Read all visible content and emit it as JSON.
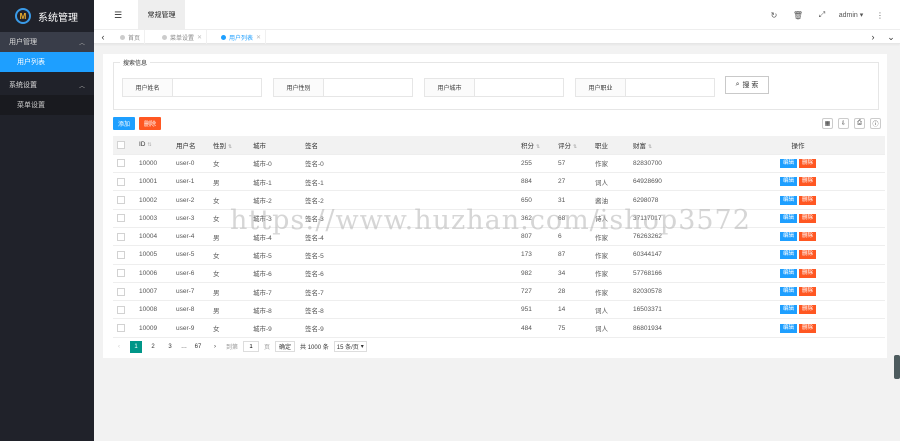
{
  "app": {
    "title": "系统管理"
  },
  "sidebar": {
    "groups": [
      {
        "label": "用户管理",
        "items": [
          "用户列表"
        ]
      },
      {
        "label": "系统设置",
        "items": [
          "菜单设置"
        ]
      }
    ]
  },
  "header": {
    "tab": "常规管理",
    "user": "admin",
    "icons": [
      "refresh-icon",
      "trash-icon",
      "fullscreen-icon",
      "more-icon"
    ]
  },
  "tabs": [
    {
      "label": "首页"
    },
    {
      "label": "菜单设置"
    },
    {
      "label": "用户列表"
    }
  ],
  "search": {
    "legend": "搜索信息",
    "fields": [
      "用户姓名",
      "用户性别",
      "用户城市",
      "用户职业"
    ],
    "button": "搜 索"
  },
  "actions": {
    "add": "添加",
    "delete": "删除"
  },
  "colors": {
    "blue": "#1e9fff",
    "orange": "#ff5722",
    "green": "#009688",
    "dark": "#20222a"
  },
  "table": {
    "columns": [
      "ID",
      "用户名",
      "性别",
      "城市",
      "签名",
      "积分",
      "评分",
      "职业",
      "财富",
      "操作"
    ],
    "edit_label": "编辑",
    "delete_label": "删除",
    "rows": [
      [
        "10000",
        "user-0",
        "女",
        "城市-0",
        "签名-0",
        "255",
        "57",
        "作家",
        "82830700"
      ],
      [
        "10001",
        "user-1",
        "男",
        "城市-1",
        "签名-1",
        "884",
        "27",
        "词人",
        "64928690"
      ],
      [
        "10002",
        "user-2",
        "女",
        "城市-2",
        "签名-2",
        "650",
        "31",
        "酱油",
        "6298078"
      ],
      [
        "10003",
        "user-3",
        "女",
        "城市-3",
        "签名-3",
        "362",
        "68",
        "诗人",
        "37117017"
      ],
      [
        "10004",
        "user-4",
        "男",
        "城市-4",
        "签名-4",
        "807",
        "6",
        "作家",
        "76263262"
      ],
      [
        "10005",
        "user-5",
        "女",
        "城市-5",
        "签名-5",
        "173",
        "87",
        "作家",
        "60344147"
      ],
      [
        "10006",
        "user-6",
        "女",
        "城市-6",
        "签名-6",
        "982",
        "34",
        "作家",
        "57768166"
      ],
      [
        "10007",
        "user-7",
        "男",
        "城市-7",
        "签名-7",
        "727",
        "28",
        "作家",
        "82030578"
      ],
      [
        "10008",
        "user-8",
        "男",
        "城市-8",
        "签名-8",
        "951",
        "14",
        "词人",
        "16503371"
      ],
      [
        "10009",
        "user-9",
        "女",
        "城市-9",
        "签名-9",
        "484",
        "75",
        "词人",
        "86801934"
      ]
    ]
  },
  "pager": {
    "pages": [
      "1",
      "2",
      "3",
      "…",
      "67"
    ],
    "goto": "到第",
    "page_input": "1",
    "page_unit": "页",
    "confirm": "确定",
    "total": "共 1000 条",
    "size": "15 条/页"
  },
  "watermark": "https://www.huzhan.com/ishop3572"
}
